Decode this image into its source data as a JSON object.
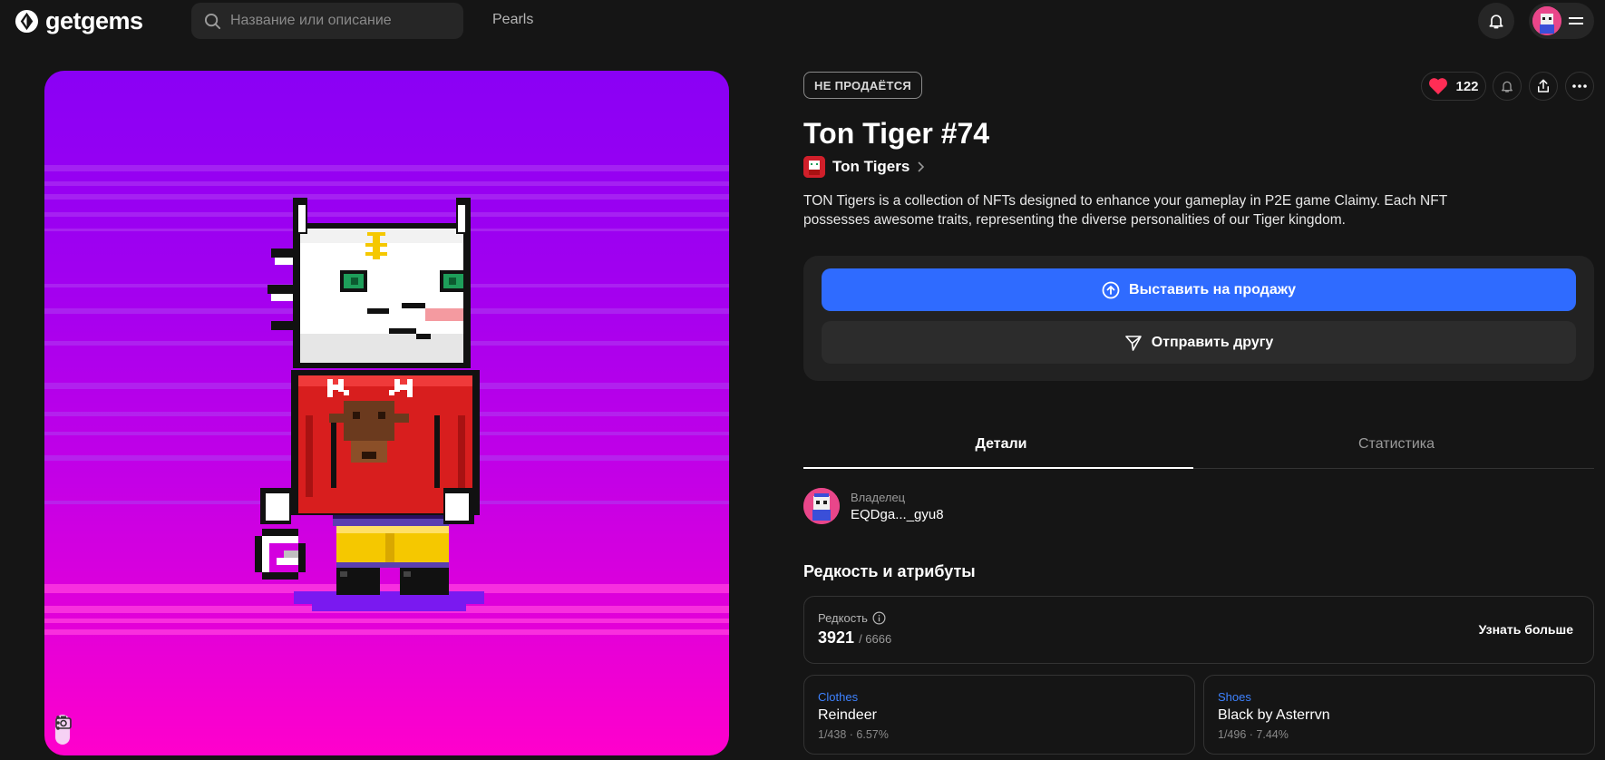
{
  "brand": {
    "name": "getgems"
  },
  "header": {
    "search_placeholder": "Название или описание",
    "nav_pearls": "Pearls",
    "icons": [
      "search-icon",
      "bell-icon",
      "menu-icon"
    ]
  },
  "nft": {
    "status": "НЕ ПРОДАЁТСЯ",
    "likes": "122",
    "title": "Ton Tiger #74",
    "collection": "Ton Tigers",
    "description": "TON Tigers is a collection of NFTs designed to enhance your gameplay in P2E game Claimy. Each NFT possesses awesome traits, representing the diverse personalities of our Tiger kingdom."
  },
  "actions": {
    "sell_label": "Выставить на продажу",
    "send_label": "Отправить другу"
  },
  "tabs": [
    {
      "label": "Детали",
      "active": true
    },
    {
      "label": "Статистика",
      "active": false
    }
  ],
  "owner": {
    "label": "Владелец",
    "address": "EQDga..._gyu8"
  },
  "rarity_section": {
    "title": "Редкость и атрибуты",
    "rarity_label": "Редкость",
    "rarity_rank": "3921",
    "rarity_total": "/ 6666",
    "learn_more": "Узнать больше"
  },
  "attributes": [
    {
      "type": "Clothes",
      "value": "Reindeer",
      "stat": "1/438 · 6.57%"
    },
    {
      "type": "Shoes",
      "value": "Black by Asterrvn",
      "stat": "1/496 · 7.44%"
    }
  ],
  "colors": {
    "background": "#151515",
    "accent_blue": "#2f6bff",
    "attribute_blue": "#3e82ff",
    "like_red": "#ff2d55"
  }
}
